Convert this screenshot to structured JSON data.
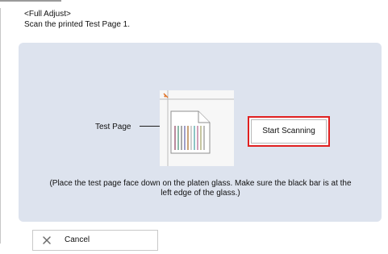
{
  "header": {
    "title": "<Full Adjust>",
    "instruction": "Scan the printed Test Page 1."
  },
  "panel": {
    "test_page_label": "Test Page",
    "start_button_label": "Start Scanning",
    "placement_note_line1": "(Place the test page face down on the platen glass. Make sure the black bar is at the",
    "placement_note_line2": "left edge of the glass.)"
  },
  "footer": {
    "cancel_label": "Cancel"
  },
  "icons": {
    "illustration": "scanner-test-page-icon",
    "cancel": "close-icon"
  },
  "colors": {
    "panel_background": "#dde3ee",
    "highlight_border": "#e02020"
  }
}
